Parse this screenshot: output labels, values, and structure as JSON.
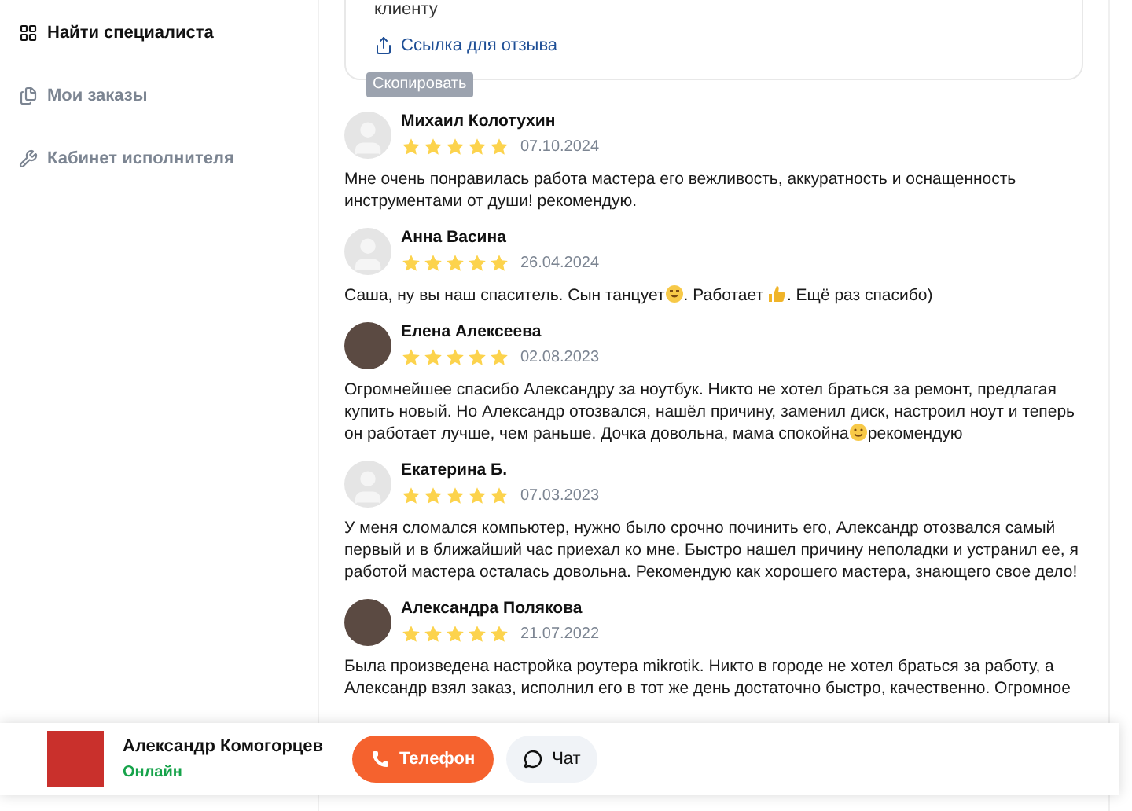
{
  "sidebar": {
    "items": [
      {
        "label": "Найти специалиста",
        "selected": true
      },
      {
        "label": "Мои заказы",
        "selected": false
      },
      {
        "label": "Кабинет исполнителя",
        "selected": false
      }
    ]
  },
  "share_card": {
    "text_cut": "клиенту",
    "link": "Ссылка для отзыва",
    "tooltip": "Скопировать"
  },
  "reviews": [
    {
      "name": "Михаил Колотухин",
      "kind": "placeholder",
      "stars": 5,
      "date": "07.10.2024",
      "segments": [
        {
          "kind": "text",
          "text": "Мне очень понравилась работа мастера его вежливость, аккуратность и оснащенность инструментами от души! рекомендую."
        }
      ]
    },
    {
      "name": "Анна Васина",
      "kind": "placeholder",
      "stars": 5,
      "date": "26.04.2024",
      "segments": [
        {
          "kind": "text",
          "text": "Саша, ну вы наш спаситель. Сын танцует"
        },
        {
          "kind": "laugh"
        },
        {
          "kind": "text",
          "text": ". Работает "
        },
        {
          "kind": "thumb"
        },
        {
          "kind": "text",
          "text": ". Ещё раз спасибо)"
        }
      ]
    },
    {
      "name": "Елена Алексеева",
      "kind": "photo",
      "stars": 5,
      "date": "02.08.2023",
      "segments": [
        {
          "kind": "text",
          "text": "Огромнейшее спасибо Александру за ноутбук. Никто не хотел браться за ремонт, предлагая купить новый. Но Александр отозвался, нашёл причину, заменил диск, настроил ноут и теперь он работает лучше, чем раньше. Дочка довольна, мама спокойна"
        },
        {
          "kind": "smile"
        },
        {
          "kind": "text",
          "text": "рекомендую"
        }
      ]
    },
    {
      "name": "Екатерина Б.",
      "kind": "placeholder",
      "stars": 5,
      "date": "07.03.2023",
      "segments": [
        {
          "kind": "text",
          "text": "У меня сломался компьютер, нужно было срочно починить его, Александр отозвался самый первый и в ближайший час приехал ко мне. Быстро нашел причину неполадки и устранил ее, я работой мастера осталась довольна. Рекомендую как хорошего мастера, знающего свое дело!"
        }
      ]
    },
    {
      "name": "Александра Полякова",
      "kind": "photo",
      "stars": 5,
      "date": "21.07.2022",
      "segments": [
        {
          "kind": "text",
          "text": "Была произведена настройка роутера mikrotik. Никто в городе не хотел браться за работу, а Александр взял заказ, исполнил его в тот же день достаточно быстро, качественно. Огромное"
        }
      ]
    }
  ],
  "contact_bar": {
    "name": "Александр Комогорцев",
    "status": "Онлайн",
    "online": true,
    "buttons": [
      {
        "kind": "phone",
        "label": "Телефон"
      },
      {
        "kind": "chat",
        "label": "Чат"
      }
    ]
  }
}
